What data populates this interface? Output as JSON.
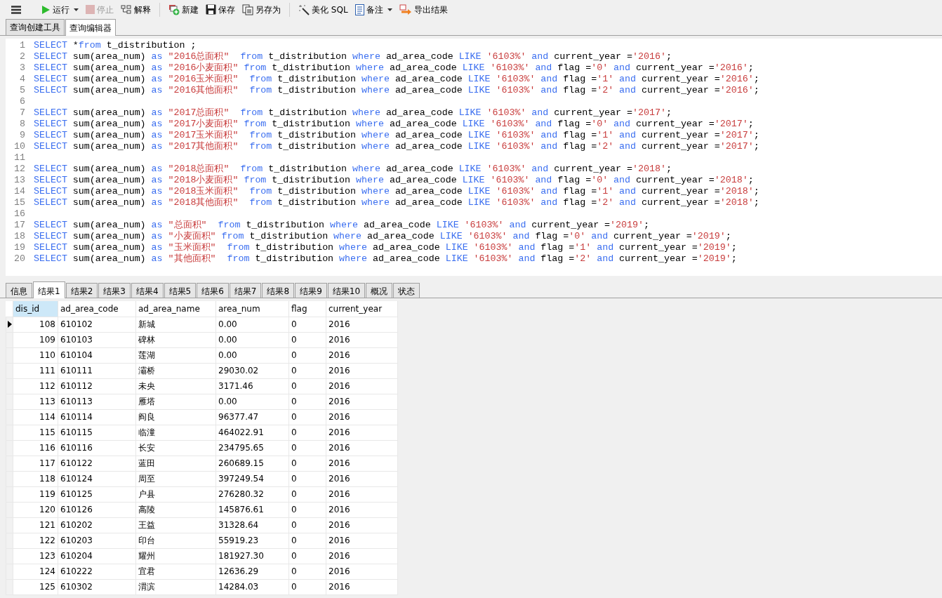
{
  "toolbar": {
    "items": [
      {
        "kind": "menu"
      },
      {
        "kind": "button",
        "label": "运行",
        "dropdown": true,
        "disabled": false
      },
      {
        "kind": "button",
        "label": "停止",
        "dropdown": false,
        "disabled": true
      },
      {
        "kind": "button",
        "label": "解释",
        "dropdown": false,
        "disabled": false
      },
      {
        "kind": "separator"
      },
      {
        "kind": "button",
        "label": "新建",
        "dropdown": false,
        "disabled": false
      },
      {
        "kind": "button",
        "label": "保存",
        "dropdown": false,
        "disabled": false
      },
      {
        "kind": "button",
        "label": "另存为",
        "dropdown": false,
        "disabled": false
      },
      {
        "kind": "separator"
      },
      {
        "kind": "button",
        "label": "美化 SQL",
        "dropdown": false,
        "disabled": false
      },
      {
        "kind": "button",
        "label": "备注",
        "dropdown": true,
        "disabled": false
      },
      {
        "kind": "button",
        "label": "导出结果",
        "dropdown": false,
        "disabled": false
      }
    ]
  },
  "tabs": [
    {
      "label": "查询创建工具",
      "selected": false
    },
    {
      "label": "查询编辑器",
      "selected": true
    }
  ],
  "editor": {
    "lines": [
      {
        "number": "1",
        "tokens": [
          {
            "kind": "kw",
            "text": "SELECT"
          },
          {
            "kind": "id",
            "text": " *"
          },
          {
            "kind": "kw",
            "text": "from"
          },
          {
            "kind": "id",
            "text": " t_distribution ;"
          }
        ]
      },
      {
        "number": "2",
        "tokens": [
          {
            "kind": "kw",
            "text": "SELECT"
          },
          {
            "kind": "id",
            "text": " sum(area_num) "
          },
          {
            "kind": "kw",
            "text": "as "
          },
          {
            "kind": "str",
            "text": "\"2016总面积\""
          },
          {
            "kind": "kw",
            "text": "  from"
          },
          {
            "kind": "id",
            "text": " t_distribution "
          },
          {
            "kind": "kw",
            "text": "where"
          },
          {
            "kind": "id",
            "text": " ad_area_code "
          },
          {
            "kind": "kw",
            "text": "LIKE "
          },
          {
            "kind": "str",
            "text": "'6103%'"
          },
          {
            "kind": "kw",
            "text": " and"
          },
          {
            "kind": "id",
            "text": " current_year ="
          },
          {
            "kind": "str",
            "text": "'2016'"
          },
          {
            "kind": "id",
            "text": ";"
          }
        ]
      },
      {
        "number": "3",
        "tokens": [
          {
            "kind": "kw",
            "text": "SELECT"
          },
          {
            "kind": "id",
            "text": " sum(area_num) "
          },
          {
            "kind": "kw",
            "text": "as "
          },
          {
            "kind": "str",
            "text": "\"2016小麦面积\""
          },
          {
            "kind": "kw",
            "text": " from"
          },
          {
            "kind": "id",
            "text": " t_distribution "
          },
          {
            "kind": "kw",
            "text": "where"
          },
          {
            "kind": "id",
            "text": " ad_area_code "
          },
          {
            "kind": "kw",
            "text": "LIKE "
          },
          {
            "kind": "str",
            "text": "'6103%'"
          },
          {
            "kind": "kw",
            "text": " and"
          },
          {
            "kind": "id",
            "text": " flag ="
          },
          {
            "kind": "str",
            "text": "'0'"
          },
          {
            "kind": "kw",
            "text": " and"
          },
          {
            "kind": "id",
            "text": " current_year ="
          },
          {
            "kind": "str",
            "text": "'2016'"
          },
          {
            "kind": "id",
            "text": ";"
          }
        ]
      },
      {
        "number": "4",
        "tokens": [
          {
            "kind": "kw",
            "text": "SELECT"
          },
          {
            "kind": "id",
            "text": " sum(area_num) "
          },
          {
            "kind": "kw",
            "text": "as "
          },
          {
            "kind": "str",
            "text": "\"2016玉米面积\""
          },
          {
            "kind": "kw",
            "text": "  from"
          },
          {
            "kind": "id",
            "text": " t_distribution "
          },
          {
            "kind": "kw",
            "text": "where"
          },
          {
            "kind": "id",
            "text": " ad_area_code "
          },
          {
            "kind": "kw",
            "text": "LIKE "
          },
          {
            "kind": "str",
            "text": "'6103%'"
          },
          {
            "kind": "kw",
            "text": " and"
          },
          {
            "kind": "id",
            "text": " flag ="
          },
          {
            "kind": "str",
            "text": "'1'"
          },
          {
            "kind": "kw",
            "text": " and"
          },
          {
            "kind": "id",
            "text": " current_year ="
          },
          {
            "kind": "str",
            "text": "'2016'"
          },
          {
            "kind": "id",
            "text": ";"
          }
        ]
      },
      {
        "number": "5",
        "tokens": [
          {
            "kind": "kw",
            "text": "SELECT"
          },
          {
            "kind": "id",
            "text": " sum(area_num) "
          },
          {
            "kind": "kw",
            "text": "as "
          },
          {
            "kind": "str",
            "text": "\"2016其他面积\""
          },
          {
            "kind": "kw",
            "text": "  from"
          },
          {
            "kind": "id",
            "text": " t_distribution "
          },
          {
            "kind": "kw",
            "text": "where"
          },
          {
            "kind": "id",
            "text": " ad_area_code "
          },
          {
            "kind": "kw",
            "text": "LIKE "
          },
          {
            "kind": "str",
            "text": "'6103%'"
          },
          {
            "kind": "kw",
            "text": " and"
          },
          {
            "kind": "id",
            "text": " flag ="
          },
          {
            "kind": "str",
            "text": "'2'"
          },
          {
            "kind": "kw",
            "text": " and"
          },
          {
            "kind": "id",
            "text": " current_year ="
          },
          {
            "kind": "str",
            "text": "'2016'"
          },
          {
            "kind": "id",
            "text": ";"
          }
        ]
      },
      {
        "number": "6"
      },
      {
        "number": "7",
        "tokens": [
          {
            "kind": "kw",
            "text": "SELECT"
          },
          {
            "kind": "id",
            "text": " sum(area_num) "
          },
          {
            "kind": "kw",
            "text": "as "
          },
          {
            "kind": "str",
            "text": "\"2017总面积\""
          },
          {
            "kind": "kw",
            "text": "  from"
          },
          {
            "kind": "id",
            "text": " t_distribution "
          },
          {
            "kind": "kw",
            "text": "where"
          },
          {
            "kind": "id",
            "text": " ad_area_code "
          },
          {
            "kind": "kw",
            "text": "LIKE "
          },
          {
            "kind": "str",
            "text": "'6103%'"
          },
          {
            "kind": "kw",
            "text": " and"
          },
          {
            "kind": "id",
            "text": " current_year ="
          },
          {
            "kind": "str",
            "text": "'2017'"
          },
          {
            "kind": "id",
            "text": ";"
          }
        ]
      },
      {
        "number": "8",
        "tokens": [
          {
            "kind": "kw",
            "text": "SELECT"
          },
          {
            "kind": "id",
            "text": " sum(area_num) "
          },
          {
            "kind": "kw",
            "text": "as "
          },
          {
            "kind": "str",
            "text": "\"2017小麦面积\""
          },
          {
            "kind": "kw",
            "text": " from"
          },
          {
            "kind": "id",
            "text": " t_distribution "
          },
          {
            "kind": "kw",
            "text": "where"
          },
          {
            "kind": "id",
            "text": " ad_area_code "
          },
          {
            "kind": "kw",
            "text": "LIKE "
          },
          {
            "kind": "str",
            "text": "'6103%'"
          },
          {
            "kind": "kw",
            "text": " and"
          },
          {
            "kind": "id",
            "text": " flag ="
          },
          {
            "kind": "str",
            "text": "'0'"
          },
          {
            "kind": "kw",
            "text": " and"
          },
          {
            "kind": "id",
            "text": " current_year ="
          },
          {
            "kind": "str",
            "text": "'2017'"
          },
          {
            "kind": "id",
            "text": ";"
          }
        ]
      },
      {
        "number": "9",
        "tokens": [
          {
            "kind": "kw",
            "text": "SELECT"
          },
          {
            "kind": "id",
            "text": " sum(area_num) "
          },
          {
            "kind": "kw",
            "text": "as "
          },
          {
            "kind": "str",
            "text": "\"2017玉米面积\""
          },
          {
            "kind": "kw",
            "text": "  from"
          },
          {
            "kind": "id",
            "text": " t_distribution "
          },
          {
            "kind": "kw",
            "text": "where"
          },
          {
            "kind": "id",
            "text": " ad_area_code "
          },
          {
            "kind": "kw",
            "text": "LIKE "
          },
          {
            "kind": "str",
            "text": "'6103%'"
          },
          {
            "kind": "kw",
            "text": " and"
          },
          {
            "kind": "id",
            "text": " flag ="
          },
          {
            "kind": "str",
            "text": "'1'"
          },
          {
            "kind": "kw",
            "text": " and"
          },
          {
            "kind": "id",
            "text": " current_year ="
          },
          {
            "kind": "str",
            "text": "'2017'"
          },
          {
            "kind": "id",
            "text": ";"
          }
        ]
      },
      {
        "number": "10",
        "tokens": [
          {
            "kind": "kw",
            "text": "SELECT"
          },
          {
            "kind": "id",
            "text": " sum(area_num) "
          },
          {
            "kind": "kw",
            "text": "as "
          },
          {
            "kind": "str",
            "text": "\"2017其他面积\""
          },
          {
            "kind": "kw",
            "text": "  from"
          },
          {
            "kind": "id",
            "text": " t_distribution "
          },
          {
            "kind": "kw",
            "text": "where"
          },
          {
            "kind": "id",
            "text": " ad_area_code "
          },
          {
            "kind": "kw",
            "text": "LIKE "
          },
          {
            "kind": "str",
            "text": "'6103%'"
          },
          {
            "kind": "kw",
            "text": " and"
          },
          {
            "kind": "id",
            "text": " flag ="
          },
          {
            "kind": "str",
            "text": "'2'"
          },
          {
            "kind": "kw",
            "text": " and"
          },
          {
            "kind": "id",
            "text": " current_year ="
          },
          {
            "kind": "str",
            "text": "'2017'"
          },
          {
            "kind": "id",
            "text": ";"
          }
        ]
      },
      {
        "number": "11"
      },
      {
        "number": "12",
        "tokens": [
          {
            "kind": "kw",
            "text": "SELECT"
          },
          {
            "kind": "id",
            "text": " sum(area_num) "
          },
          {
            "kind": "kw",
            "text": "as "
          },
          {
            "kind": "str",
            "text": "\"2018总面积\""
          },
          {
            "kind": "kw",
            "text": "  from"
          },
          {
            "kind": "id",
            "text": " t_distribution "
          },
          {
            "kind": "kw",
            "text": "where"
          },
          {
            "kind": "id",
            "text": " ad_area_code "
          },
          {
            "kind": "kw",
            "text": "LIKE "
          },
          {
            "kind": "str",
            "text": "'6103%'"
          },
          {
            "kind": "kw",
            "text": " and"
          },
          {
            "kind": "id",
            "text": " current_year ="
          },
          {
            "kind": "str",
            "text": "'2018'"
          },
          {
            "kind": "id",
            "text": ";"
          }
        ]
      },
      {
        "number": "13",
        "tokens": [
          {
            "kind": "kw",
            "text": "SELECT"
          },
          {
            "kind": "id",
            "text": " sum(area_num) "
          },
          {
            "kind": "kw",
            "text": "as "
          },
          {
            "kind": "str",
            "text": "\"2018小麦面积\""
          },
          {
            "kind": "kw",
            "text": " from"
          },
          {
            "kind": "id",
            "text": " t_distribution "
          },
          {
            "kind": "kw",
            "text": "where"
          },
          {
            "kind": "id",
            "text": " ad_area_code "
          },
          {
            "kind": "kw",
            "text": "LIKE "
          },
          {
            "kind": "str",
            "text": "'6103%'"
          },
          {
            "kind": "kw",
            "text": " and"
          },
          {
            "kind": "id",
            "text": " flag ="
          },
          {
            "kind": "str",
            "text": "'0'"
          },
          {
            "kind": "kw",
            "text": " and"
          },
          {
            "kind": "id",
            "text": " current_year ="
          },
          {
            "kind": "str",
            "text": "'2018'"
          },
          {
            "kind": "id",
            "text": ";"
          }
        ]
      },
      {
        "number": "14",
        "tokens": [
          {
            "kind": "kw",
            "text": "SELECT"
          },
          {
            "kind": "id",
            "text": " sum(area_num) "
          },
          {
            "kind": "kw",
            "text": "as "
          },
          {
            "kind": "str",
            "text": "\"2018玉米面积\""
          },
          {
            "kind": "kw",
            "text": "  from"
          },
          {
            "kind": "id",
            "text": " t_distribution "
          },
          {
            "kind": "kw",
            "text": "where"
          },
          {
            "kind": "id",
            "text": " ad_area_code "
          },
          {
            "kind": "kw",
            "text": "LIKE "
          },
          {
            "kind": "str",
            "text": "'6103%'"
          },
          {
            "kind": "kw",
            "text": " and"
          },
          {
            "kind": "id",
            "text": " flag ="
          },
          {
            "kind": "str",
            "text": "'1'"
          },
          {
            "kind": "kw",
            "text": " and"
          },
          {
            "kind": "id",
            "text": " current_year ="
          },
          {
            "kind": "str",
            "text": "'2018'"
          },
          {
            "kind": "id",
            "text": ";"
          }
        ]
      },
      {
        "number": "15",
        "tokens": [
          {
            "kind": "kw",
            "text": "SELECT"
          },
          {
            "kind": "id",
            "text": " sum(area_num) "
          },
          {
            "kind": "kw",
            "text": "as "
          },
          {
            "kind": "str",
            "text": "\"2018其他面积\""
          },
          {
            "kind": "kw",
            "text": "  from"
          },
          {
            "kind": "id",
            "text": " t_distribution "
          },
          {
            "kind": "kw",
            "text": "where"
          },
          {
            "kind": "id",
            "text": " ad_area_code "
          },
          {
            "kind": "kw",
            "text": "LIKE "
          },
          {
            "kind": "str",
            "text": "'6103%'"
          },
          {
            "kind": "kw",
            "text": " and"
          },
          {
            "kind": "id",
            "text": " flag ="
          },
          {
            "kind": "str",
            "text": "'2'"
          },
          {
            "kind": "kw",
            "text": " and"
          },
          {
            "kind": "id",
            "text": " current_year ="
          },
          {
            "kind": "str",
            "text": "'2018'"
          },
          {
            "kind": "id",
            "text": ";"
          }
        ]
      },
      {
        "number": "16"
      },
      {
        "number": "17",
        "tokens": [
          {
            "kind": "kw",
            "text": "SELECT"
          },
          {
            "kind": "id",
            "text": " sum(area_num) "
          },
          {
            "kind": "kw",
            "text": "as "
          },
          {
            "kind": "str",
            "text": "\"总面积\""
          },
          {
            "kind": "kw",
            "text": "  from"
          },
          {
            "kind": "id",
            "text": " t_distribution "
          },
          {
            "kind": "kw",
            "text": "where"
          },
          {
            "kind": "id",
            "text": " ad_area_code "
          },
          {
            "kind": "kw",
            "text": "LIKE "
          },
          {
            "kind": "str",
            "text": "'6103%'"
          },
          {
            "kind": "kw",
            "text": " and"
          },
          {
            "kind": "id",
            "text": " current_year ="
          },
          {
            "kind": "str",
            "text": "'2019'"
          },
          {
            "kind": "id",
            "text": ";"
          }
        ]
      },
      {
        "number": "18",
        "tokens": [
          {
            "kind": "kw",
            "text": "SELECT"
          },
          {
            "kind": "id",
            "text": " sum(area_num) "
          },
          {
            "kind": "kw",
            "text": "as "
          },
          {
            "kind": "str",
            "text": "\"小麦面积\""
          },
          {
            "kind": "kw",
            "text": " from"
          },
          {
            "kind": "id",
            "text": " t_distribution "
          },
          {
            "kind": "kw",
            "text": "where"
          },
          {
            "kind": "id",
            "text": " ad_area_code "
          },
          {
            "kind": "kw",
            "text": "LIKE "
          },
          {
            "kind": "str",
            "text": "'6103%'"
          },
          {
            "kind": "kw",
            "text": " and"
          },
          {
            "kind": "id",
            "text": " flag ="
          },
          {
            "kind": "str",
            "text": "'0'"
          },
          {
            "kind": "kw",
            "text": " and"
          },
          {
            "kind": "id",
            "text": " current_year ="
          },
          {
            "kind": "str",
            "text": "'2019'"
          },
          {
            "kind": "id",
            "text": ";"
          }
        ]
      },
      {
        "number": "19",
        "tokens": [
          {
            "kind": "kw",
            "text": "SELECT"
          },
          {
            "kind": "id",
            "text": " sum(area_num) "
          },
          {
            "kind": "kw",
            "text": "as "
          },
          {
            "kind": "str",
            "text": "\"玉米面积\""
          },
          {
            "kind": "kw",
            "text": "  from"
          },
          {
            "kind": "id",
            "text": " t_distribution "
          },
          {
            "kind": "kw",
            "text": "where"
          },
          {
            "kind": "id",
            "text": " ad_area_code "
          },
          {
            "kind": "kw",
            "text": "LIKE "
          },
          {
            "kind": "str",
            "text": "'6103%'"
          },
          {
            "kind": "kw",
            "text": " and"
          },
          {
            "kind": "id",
            "text": " flag ="
          },
          {
            "kind": "str",
            "text": "'1'"
          },
          {
            "kind": "kw",
            "text": " and"
          },
          {
            "kind": "id",
            "text": " current_year ="
          },
          {
            "kind": "str",
            "text": "'2019'"
          },
          {
            "kind": "id",
            "text": ";"
          }
        ]
      },
      {
        "number": "20",
        "tokens": [
          {
            "kind": "kw",
            "text": "SELECT"
          },
          {
            "kind": "id",
            "text": " sum(area_num) "
          },
          {
            "kind": "kw",
            "text": "as "
          },
          {
            "kind": "str",
            "text": "\"其他面积\""
          },
          {
            "kind": "kw",
            "text": "  from"
          },
          {
            "kind": "id",
            "text": " t_distribution "
          },
          {
            "kind": "kw",
            "text": "where"
          },
          {
            "kind": "id",
            "text": " ad_area_code "
          },
          {
            "kind": "kw",
            "text": "LIKE "
          },
          {
            "kind": "str",
            "text": "'6103%'"
          },
          {
            "kind": "kw",
            "text": " and"
          },
          {
            "kind": "id",
            "text": " flag ="
          },
          {
            "kind": "str",
            "text": "'2'"
          },
          {
            "kind": "kw",
            "text": " and"
          },
          {
            "kind": "id",
            "text": " current_year ="
          },
          {
            "kind": "str",
            "text": "'2019'"
          },
          {
            "kind": "id",
            "text": ";"
          }
        ]
      }
    ]
  },
  "result_tabs": [
    {
      "label": "信息",
      "selected": false
    },
    {
      "label": "结果1",
      "selected": true
    },
    {
      "label": "结果2",
      "selected": false
    },
    {
      "label": "结果3",
      "selected": false
    },
    {
      "label": "结果4",
      "selected": false
    },
    {
      "label": "结果5",
      "selected": false
    },
    {
      "label": "结果6",
      "selected": false
    },
    {
      "label": "结果7",
      "selected": false
    },
    {
      "label": "结果8",
      "selected": false
    },
    {
      "label": "结果9",
      "selected": false
    },
    {
      "label": "结果10",
      "selected": false
    },
    {
      "label": "概况",
      "selected": false
    },
    {
      "label": "状态",
      "selected": false
    }
  ],
  "table": {
    "columns": [
      "dis_id",
      "ad_area_code",
      "ad_area_name",
      "area_num",
      "flag",
      "current_year"
    ],
    "rows": [
      {
        "selected": true,
        "cells": [
          "108",
          "610102",
          "新城",
          "0.00",
          "0",
          "2016"
        ]
      },
      {
        "selected": false,
        "cells": [
          "109",
          "610103",
          "碑林",
          "0.00",
          "0",
          "2016"
        ]
      },
      {
        "selected": false,
        "cells": [
          "110",
          "610104",
          "莲湖",
          "0.00",
          "0",
          "2016"
        ]
      },
      {
        "selected": false,
        "cells": [
          "111",
          "610111",
          "灞桥",
          "29030.02",
          "0",
          "2016"
        ]
      },
      {
        "selected": false,
        "cells": [
          "112",
          "610112",
          "未央",
          "3171.46",
          "0",
          "2016"
        ]
      },
      {
        "selected": false,
        "cells": [
          "113",
          "610113",
          "雁塔",
          "0.00",
          "0",
          "2016"
        ]
      },
      {
        "selected": false,
        "cells": [
          "114",
          "610114",
          "阎良",
          "96377.47",
          "0",
          "2016"
        ]
      },
      {
        "selected": false,
        "cells": [
          "115",
          "610115",
          "临潼",
          "464022.91",
          "0",
          "2016"
        ]
      },
      {
        "selected": false,
        "cells": [
          "116",
          "610116",
          "长安",
          "234795.65",
          "0",
          "2016"
        ]
      },
      {
        "selected": false,
        "cells": [
          "117",
          "610122",
          "蓝田",
          "260689.15",
          "0",
          "2016"
        ]
      },
      {
        "selected": false,
        "cells": [
          "118",
          "610124",
          "周至",
          "397249.54",
          "0",
          "2016"
        ]
      },
      {
        "selected": false,
        "cells": [
          "119",
          "610125",
          "户县",
          "276280.32",
          "0",
          "2016"
        ]
      },
      {
        "selected": false,
        "cells": [
          "120",
          "610126",
          "高陵",
          "145876.61",
          "0",
          "2016"
        ]
      },
      {
        "selected": false,
        "cells": [
          "121",
          "610202",
          "王益",
          "31328.64",
          "0",
          "2016"
        ]
      },
      {
        "selected": false,
        "cells": [
          "122",
          "610203",
          "印台",
          "55919.23",
          "0",
          "2016"
        ]
      },
      {
        "selected": false,
        "cells": [
          "123",
          "610204",
          "耀州",
          "181927.30",
          "0",
          "2016"
        ]
      },
      {
        "selected": false,
        "cells": [
          "124",
          "610222",
          "宜君",
          "12636.29",
          "0",
          "2016"
        ]
      },
      {
        "selected": false,
        "cells": [
          "125",
          "610302",
          "渭滨",
          "14284.03",
          "0",
          "2016"
        ]
      }
    ]
  }
}
